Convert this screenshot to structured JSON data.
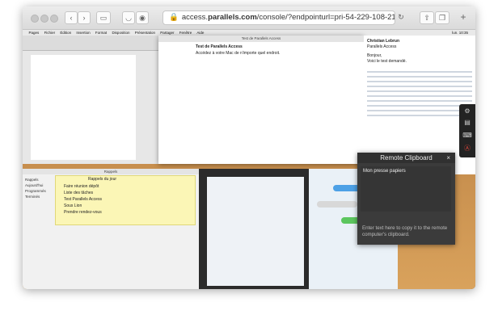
{
  "browser": {
    "url_prefix": "access.",
    "url_domain": "parallels.com",
    "url_path": "/console/?endpointurl=pri-54-229-108-215.proxy.my..."
  },
  "mac_menubar": {
    "items": [
      "Pages",
      "Fichier",
      "Édition",
      "Insertion",
      "Format",
      "Disposition",
      "Présentation",
      "Partager",
      "Fenêtre",
      "Aide"
    ],
    "clock": "lun. 10:35"
  },
  "document": {
    "window_title": "Test de Parallels Access",
    "heading": "Test de Parallels Access",
    "body": "Accédez à votre Mac de n'importe quel endroit."
  },
  "reminders": {
    "window_title": "Rappels",
    "sidebar": [
      "Rappels",
      "Aujourd'hui",
      "Programmés",
      "Terminés"
    ],
    "header": "Rappels du jour",
    "items": [
      "Faire réunion dépôt",
      "Liste des tâches",
      "Test Parallels Access",
      "Sous Lion",
      "Prendre rendez-vous"
    ]
  },
  "email": {
    "from": "Christian Lebrun",
    "subject": "Parallels Access",
    "body_lines": [
      "Bonjour,",
      "Voici le test demandé."
    ]
  },
  "remote_clipboard": {
    "title": "Remote Clipboard",
    "close_label": "×",
    "text_value": "Mon presse papiers",
    "hint": "Enter text here to copy it to the remote computer's clipboard."
  }
}
